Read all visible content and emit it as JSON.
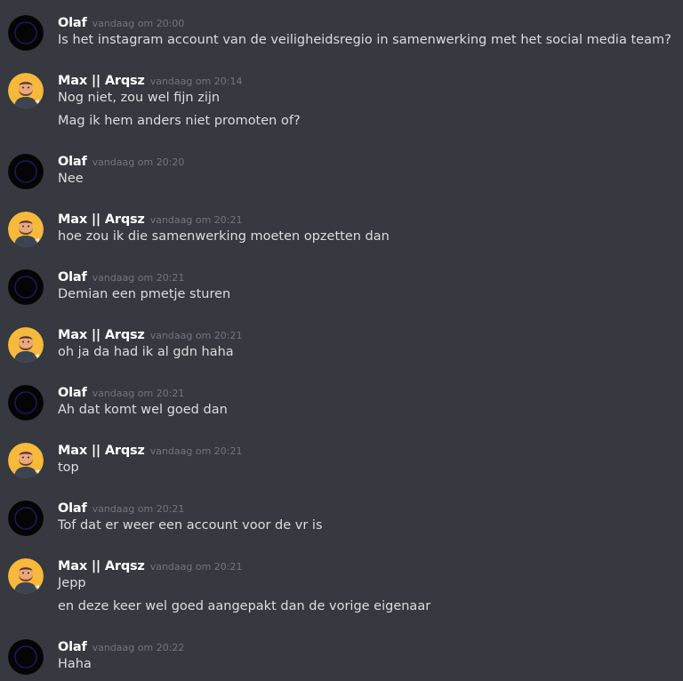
{
  "messages": [
    {
      "author": "Olaf",
      "avatar": "olaf-avatar-icon",
      "time": "vandaag om 20:00",
      "lines": [
        "Is het instagram account van de veiligheidsregio in samenwerking met het social media team?"
      ]
    },
    {
      "author": "Max || Arqsz",
      "avatar": "max-avatar-icon",
      "time": "vandaag om 20:14",
      "lines": [
        "Nog niet, zou wel fijn zijn",
        "Mag ik hem anders niet promoten of?"
      ]
    },
    {
      "author": "Olaf",
      "avatar": "olaf-avatar-icon",
      "time": "vandaag om 20:20",
      "lines": [
        "Nee"
      ]
    },
    {
      "author": "Max || Arqsz",
      "avatar": "max-avatar-icon",
      "time": "vandaag om 20:21",
      "lines": [
        "hoe zou ik die samenwerking moeten opzetten dan"
      ]
    },
    {
      "author": "Olaf",
      "avatar": "olaf-avatar-icon",
      "time": "vandaag om 20:21",
      "lines": [
        "Demian een pmetje sturen"
      ]
    },
    {
      "author": "Max || Arqsz",
      "avatar": "max-avatar-icon",
      "time": "vandaag om 20:21",
      "lines": [
        "oh ja da had ik al gdn haha"
      ]
    },
    {
      "author": "Olaf",
      "avatar": "olaf-avatar-icon",
      "time": "vandaag om 20:21",
      "lines": [
        "Ah dat komt wel goed dan"
      ]
    },
    {
      "author": "Max || Arqsz",
      "avatar": "max-avatar-icon",
      "time": "vandaag om 20:21",
      "lines": [
        "top"
      ]
    },
    {
      "author": "Olaf",
      "avatar": "olaf-avatar-icon",
      "time": "vandaag om 20:21",
      "lines": [
        "Tof dat er weer een account voor de vr is"
      ]
    },
    {
      "author": "Max || Arqsz",
      "avatar": "max-avatar-icon",
      "time": "vandaag om 20:21",
      "lines": [
        "Jepp",
        "en deze keer wel goed aangepakt dan de vorige eigenaar"
      ]
    },
    {
      "author": "Olaf",
      "avatar": "olaf-avatar-icon",
      "time": "vandaag om 20:22",
      "lines": [
        "Haha"
      ]
    }
  ],
  "colors": {
    "background": "#36393f",
    "username": "#ffffff",
    "message_text": "#dcddde",
    "timestamp": "#72767d"
  }
}
